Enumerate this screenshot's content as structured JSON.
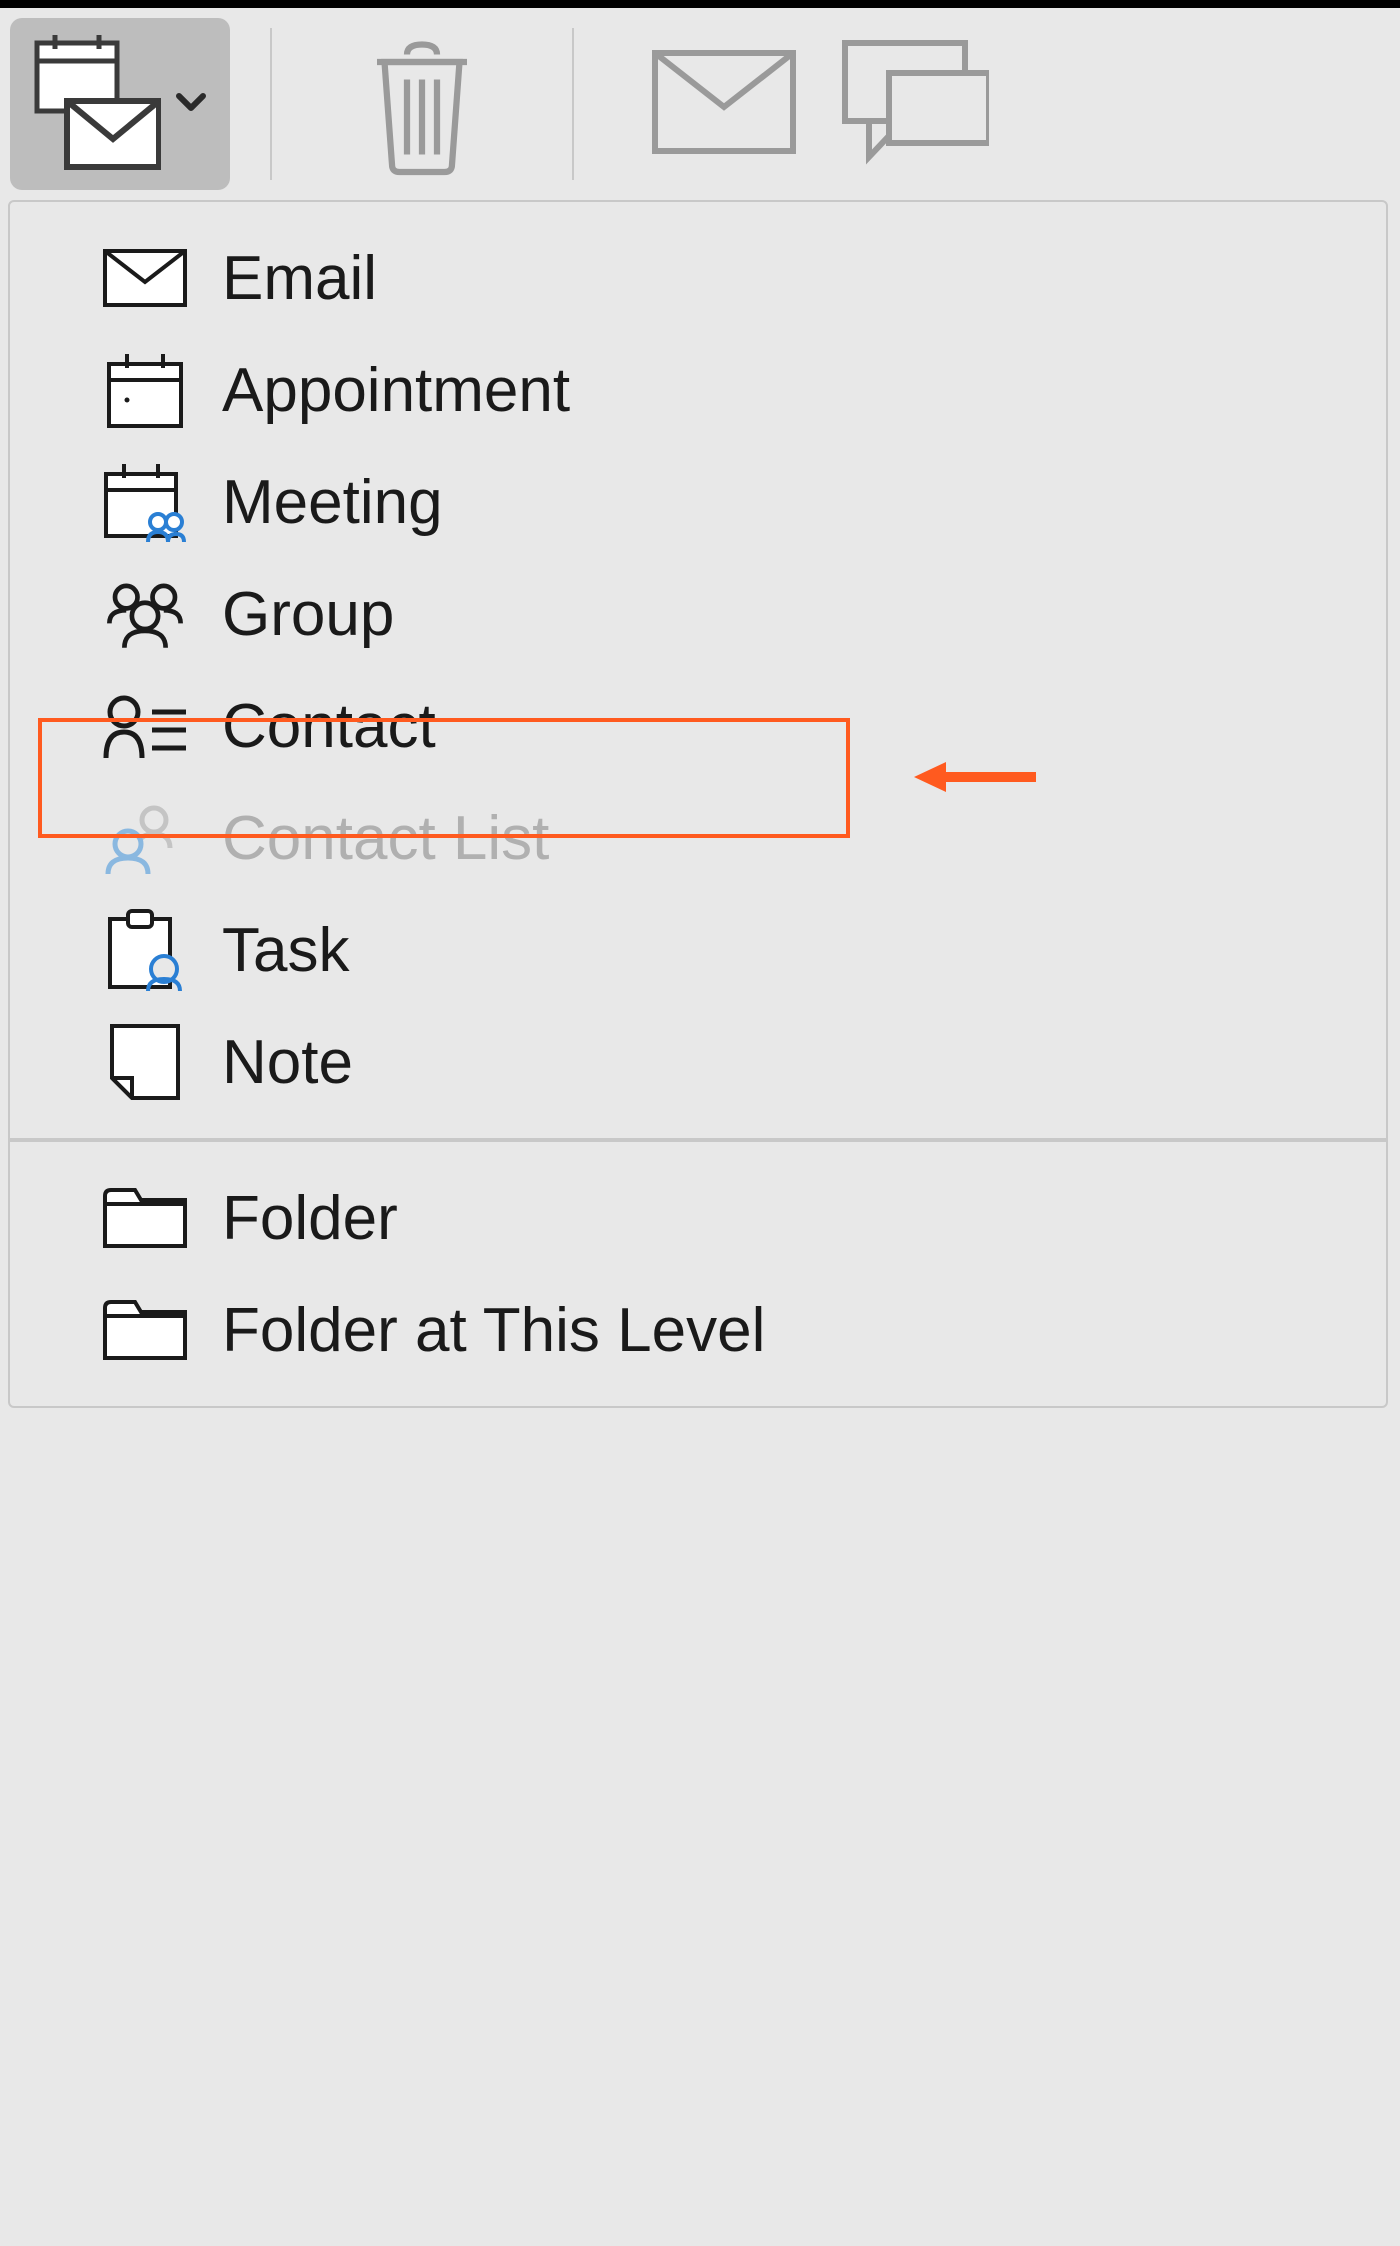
{
  "toolbar": {
    "new_button_icon": "new-items",
    "delete_icon": "trash",
    "envelope_icon": "envelope",
    "comment_icon": "comment"
  },
  "menu": {
    "items": [
      {
        "label": "Email",
        "icon": "email-icon",
        "enabled": true,
        "highlighted": false
      },
      {
        "label": "Appointment",
        "icon": "appointment-icon",
        "enabled": true,
        "highlighted": false
      },
      {
        "label": "Meeting",
        "icon": "meeting-icon",
        "enabled": true,
        "highlighted": false
      },
      {
        "label": "Group",
        "icon": "group-icon",
        "enabled": true,
        "highlighted": true
      },
      {
        "label": "Contact",
        "icon": "contact-icon",
        "enabled": true,
        "highlighted": false
      },
      {
        "label": "Contact List",
        "icon": "contact-list-icon",
        "enabled": false,
        "highlighted": false
      },
      {
        "label": "Task",
        "icon": "task-icon",
        "enabled": true,
        "highlighted": false
      },
      {
        "label": "Note",
        "icon": "note-icon",
        "enabled": true,
        "highlighted": false
      }
    ],
    "items2": [
      {
        "label": "Folder",
        "icon": "folder-icon",
        "enabled": true
      },
      {
        "label": "Folder at This Level",
        "icon": "folder-level-icon",
        "enabled": true
      }
    ]
  },
  "annotation": {
    "highlight_color": "#ff5a1f"
  }
}
